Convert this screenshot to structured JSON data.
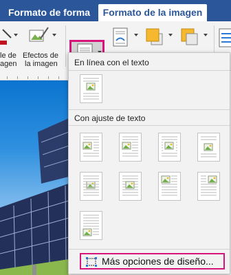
{
  "ribbon": {
    "tabs": [
      {
        "label": "Formato de forma",
        "active": false
      },
      {
        "label": "Formato de la imagen",
        "active": true
      }
    ],
    "buttons": {
      "color_label_l1": "le de",
      "color_label_l2": "agen",
      "effects_label_l1": "Efectos de",
      "effects_label_l2": "la imagen"
    },
    "accent_color": "#2b579a",
    "highlight_color": "#d6147b"
  },
  "wrap_menu": {
    "section_inline": "En línea con el texto",
    "section_wrap": "Con ajuste de texto",
    "more_options": "Más opciones de diseño...",
    "inline_icons": [
      "inline-layout-icon"
    ],
    "wrap_icons": [
      "square-wrap-icon",
      "tight-wrap-icon",
      "through-wrap-icon",
      "top-bottom-wrap-icon",
      "behind-text-icon",
      "in-front-of-text-icon",
      "top-left-fixed-icon",
      "top-right-fixed-icon",
      "bottom-left-fixed-icon"
    ]
  }
}
